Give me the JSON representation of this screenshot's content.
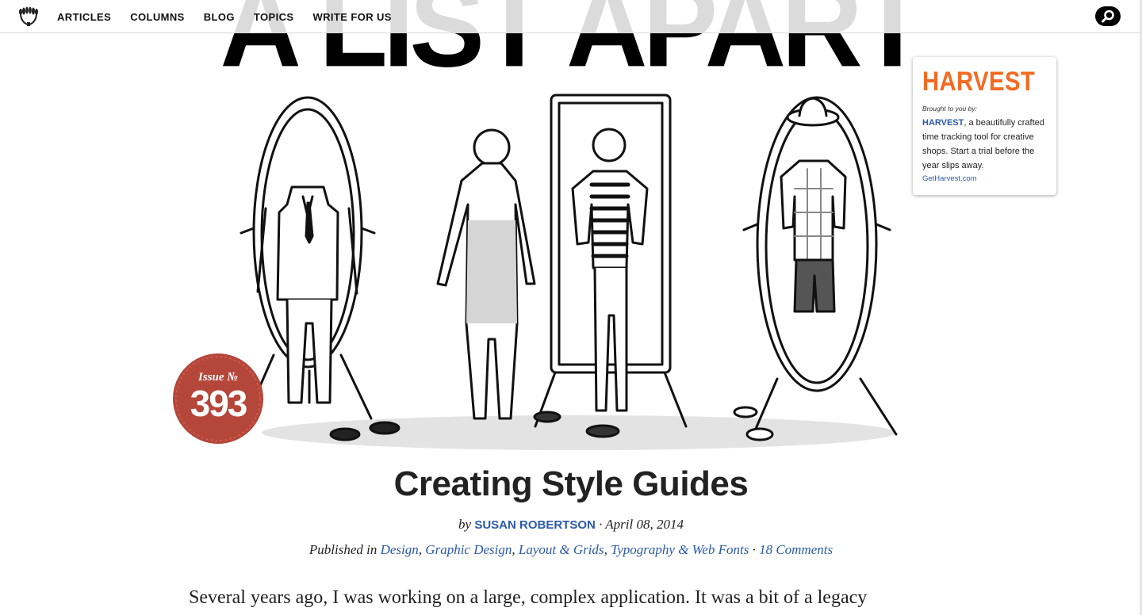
{
  "nav": {
    "items": [
      "ARTICLES",
      "COLUMNS",
      "BLOG",
      "TOPICS",
      "WRITE FOR US"
    ]
  },
  "masthead": {
    "title": "A LIST APART"
  },
  "issue": {
    "label": "Issue №",
    "number": "393"
  },
  "sponsor": {
    "logo": "HARVEST",
    "brought_by": "Brought to you by:",
    "brand": "HARVEST",
    "description": ", a beautifully crafted time tracking tool for creative shops. Start a trial before the year slips away.",
    "link": "GetHarvest.com"
  },
  "article": {
    "title": "Creating Style Guides",
    "by": "by",
    "author": "SUSAN ROBERTSON",
    "date": "· April 08, 2014",
    "published_in": "Published in",
    "topics": [
      "Design",
      "Graphic Design",
      "Layout & Grids",
      "Typography & Web Fonts"
    ],
    "comments": "18 Comments",
    "first_line": "Several years ago, I was working on a large, complex application. It was a bit of a legacy"
  },
  "colors": {
    "link_blue": "#2b5aa9",
    "harvest_orange": "#f26b22",
    "badge_red": "#b5463a"
  },
  "icons": {
    "logo": "laurel-wreath-icon",
    "search": "search-icon"
  }
}
